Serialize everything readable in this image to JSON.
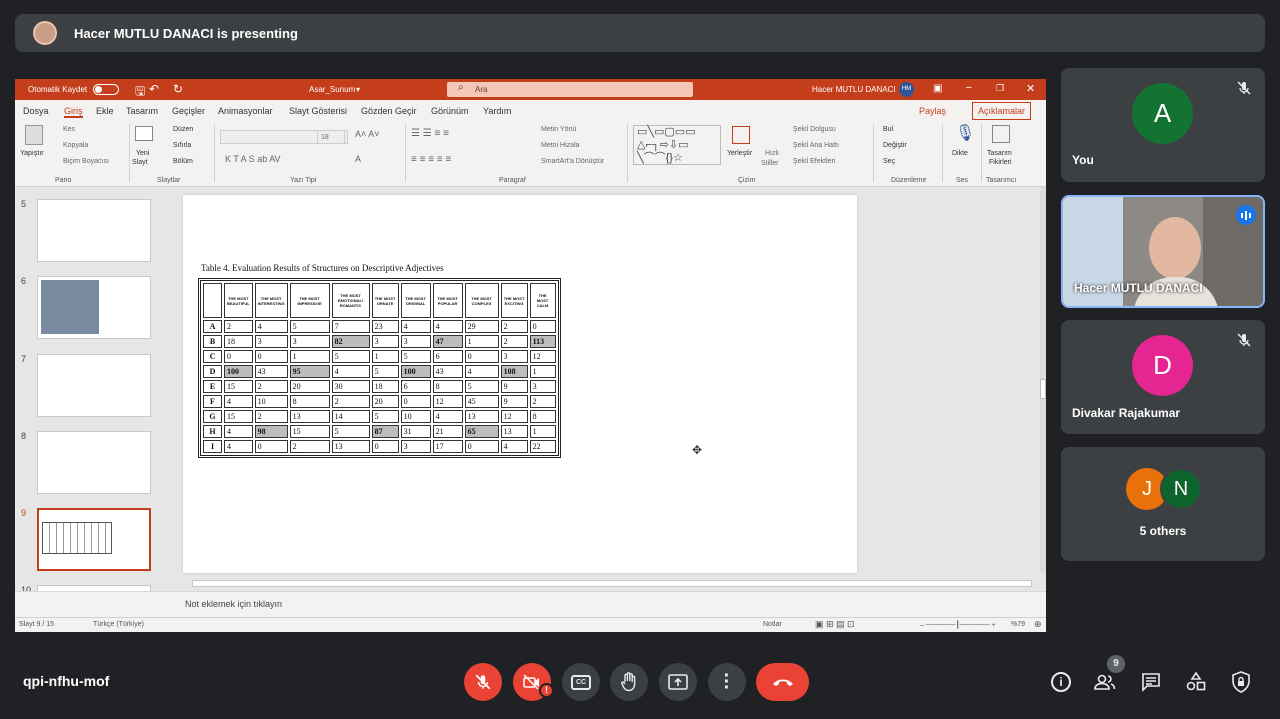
{
  "presenting_bar": {
    "text": "Hacer MUTLU DANACI is presenting"
  },
  "ppt": {
    "title_bar": {
      "autosave": "Otomatik Kaydet",
      "filename": "Asar_Sunum",
      "search_placeholder": "Ara",
      "user": "Hacer MUTLU DANACI",
      "user_initials": "HM"
    },
    "tabs": [
      "Dosya",
      "Giriş",
      "Ekle",
      "Tasarım",
      "Geçişler",
      "Animasyonlar",
      "Slayt Gösterisi",
      "Gözden Geçir",
      "Görünüm",
      "Yardım"
    ],
    "share_label": "Paylaş",
    "comments_label": "Açıklamalar",
    "ribbon": {
      "pano": {
        "paste": "Yapıştır",
        "cut": "Kes",
        "copy": "Kopyala",
        "format_painter": "Biçim Boyacısı",
        "label": "Pano"
      },
      "slaytlar": {
        "new_slide_1": "Yeni",
        "new_slide_2": "Slayt",
        "layout": "Düzen",
        "reset": "Sıfırla",
        "section": "Bölüm",
        "label": "Slaytlar"
      },
      "yazi_tipi": {
        "size": "18",
        "label": "Yazı Tipi"
      },
      "paragraf": {
        "text_direction": "Metin Yönü",
        "align_text": "Metni Hizala",
        "smartart": "SmartArt'a Dönüştür",
        "label": "Paragraf"
      },
      "cizim": {
        "arrange_1": "Yerleştir",
        "quick_styles_1": "Hızlı",
        "quick_styles_2": "Stiller",
        "shape_fill": "Şekil Dolgusu",
        "shape_outline": "Şekil Ana Hattı",
        "shape_effects": "Şekil Efektleri",
        "label": "Çizim"
      },
      "duzenleme": {
        "find": "Bul",
        "replace": "Değiştir",
        "select": "Seç",
        "label": "Düzenleme"
      },
      "ses": {
        "dictate": "Dikte",
        "label": "Ses"
      },
      "tasarimci": {
        "ideas_1": "Tasarım",
        "ideas_2": "Fikirleri",
        "label": "Tasarımcı"
      }
    },
    "thumbnails": [
      "5",
      "6",
      "7",
      "8",
      "9",
      "10"
    ],
    "selected_slide": "9",
    "slide": {
      "table_caption": "Table 4.  Evaluation Results of Structures on Descriptive Adjectives",
      "headers": [
        "THE MOST BEAUTIFUL",
        "THE MOST INTERESTING",
        "THE MOST IMPRESSIVE",
        "THE MOST EMOTIONAL/ ROMANTIC",
        "THE MOST ORNATE",
        "THE MOST ORIGINAL",
        "THE MOST POPULAR",
        "THE MOST COMPLEX",
        "THE MOST EXCITING",
        "THE MOST CALM"
      ],
      "rows": [
        {
          "label": "A",
          "values": [
            "2",
            "4",
            "5",
            "7",
            "23",
            "4",
            "4",
            "29",
            "2",
            "0"
          ],
          "highlight": []
        },
        {
          "label": "B",
          "values": [
            "18",
            "3",
            "3",
            "82",
            "3",
            "3",
            "47",
            "1",
            "2",
            "113"
          ],
          "highlight": [
            3,
            6,
            9
          ]
        },
        {
          "label": "C",
          "values": [
            "0",
            "0",
            "1",
            "5",
            "1",
            "5",
            "6",
            "0",
            "3",
            "12"
          ],
          "highlight": []
        },
        {
          "label": "D",
          "values": [
            "100",
            "43",
            "95",
            "4",
            "5",
            "100",
            "43",
            "4",
            "108",
            "1"
          ],
          "highlight": [
            0,
            2,
            5,
            8
          ]
        },
        {
          "label": "E",
          "values": [
            "15",
            "2",
            "20",
            "30",
            "18",
            "6",
            "8",
            "5",
            "9",
            "3"
          ],
          "highlight": []
        },
        {
          "label": "F",
          "values": [
            "4",
            "10",
            "8",
            "2",
            "20",
            "0",
            "12",
            "45",
            "9",
            "2"
          ],
          "highlight": []
        },
        {
          "label": "G",
          "values": [
            "15",
            "2",
            "13",
            "14",
            "5",
            "10",
            "4",
            "13",
            "12",
            "8"
          ],
          "highlight": []
        },
        {
          "label": "H",
          "values": [
            "4",
            "98",
            "15",
            "5",
            "87",
            "31",
            "21",
            "65",
            "13",
            "1"
          ],
          "highlight": [
            1,
            4,
            7
          ]
        },
        {
          "label": "I",
          "values": [
            "4",
            "0",
            "2",
            "13",
            "0",
            "3",
            "17",
            "0",
            "4",
            "22"
          ],
          "highlight": []
        }
      ]
    },
    "notes_placeholder": "Not eklemek için tıklayın",
    "status": {
      "slide_of": "Slayt 9 / 15",
      "language": "Türkçe (Türkiye)",
      "notes": "Notlar",
      "zoom": "%79"
    }
  },
  "participants": [
    {
      "initial": "A",
      "name": "You",
      "color": "#137333",
      "muted": true
    },
    {
      "name": "Hacer MUTLU DANACI",
      "speaking": true
    },
    {
      "initial": "D",
      "name": "Divakar Rajakumar",
      "color": "#e52592",
      "muted": true
    },
    {
      "initials": [
        "J",
        "N"
      ],
      "colors": [
        "#e8710a",
        "#0d652d"
      ],
      "name": "5 others"
    }
  ],
  "meeting": {
    "code": "qpi-nfhu-mof",
    "participant_count": "9"
  }
}
